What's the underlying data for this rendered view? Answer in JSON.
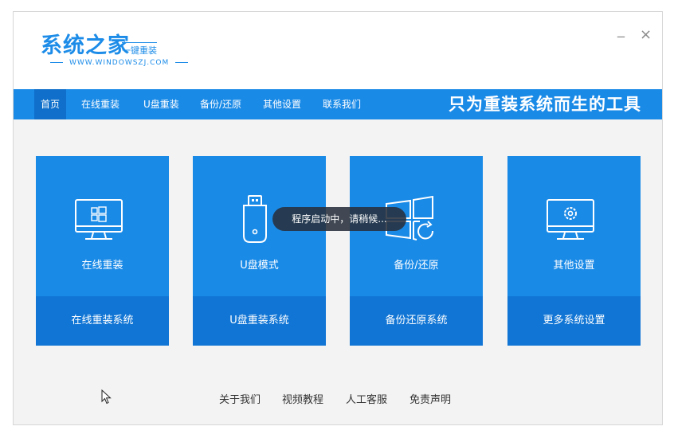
{
  "window": {
    "minimize_label": "_",
    "close_label": "×"
  },
  "logo": {
    "main": "系统之家",
    "sub": "一键重装",
    "url": "WWW.WINDOWSZJ.COM"
  },
  "nav": {
    "items": [
      "首页",
      "在线重装",
      "U盘重装",
      "备份/还原",
      "其他设置",
      "联系我们"
    ],
    "active": "首页",
    "slogan": "只为重装系统而生的工具"
  },
  "cards": [
    {
      "title": "在线重装",
      "footer": "在线重装系统",
      "icon": "monitor-windows-icon"
    },
    {
      "title": "U盘模式",
      "footer": "U盘重装系统",
      "icon": "usb-drive-icon"
    },
    {
      "title": "备份/还原",
      "footer": "备份还原系统",
      "icon": "windows-restore-icon"
    },
    {
      "title": "其他设置",
      "footer": "更多系统设置",
      "icon": "monitor-gear-icon"
    }
  ],
  "toast": "程序启动中，请稍候...",
  "footer_links": [
    "关于我们",
    "视频教程",
    "人工客服",
    "免责声明"
  ],
  "colors": {
    "primary": "#1a8ae7",
    "card_footer": "#1075d5",
    "nav_active": "#0f6fca",
    "background": "#f3f3f3"
  }
}
